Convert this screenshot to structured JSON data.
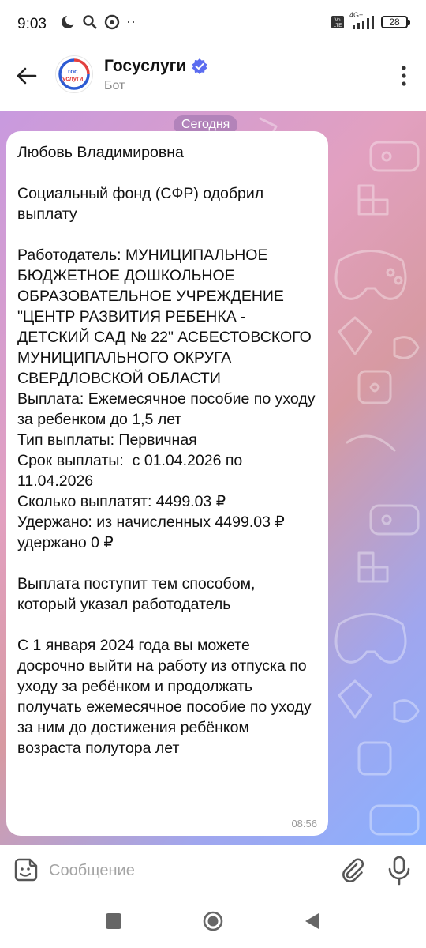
{
  "status_bar": {
    "time": "9:03",
    "battery": "28",
    "network": "4G+",
    "volte": "VoLTE"
  },
  "header": {
    "title": "Госуслуги",
    "subtitle": "Бот",
    "avatar_logo_top": "гос",
    "avatar_logo_bottom": "услуги",
    "icons": {
      "back": "arrow-left-icon",
      "verified": "verified-badge-icon",
      "menu": "more-vertical-icon"
    }
  },
  "chat": {
    "date_label": "Сегодня",
    "message": {
      "text": "Любовь Владимировна\n\nСоциальный фонд (СФР) одобрил выплату\n\nРаботодатель: МУНИЦИПАЛЬНОЕ БЮДЖЕТНОЕ ДОШКОЛЬНОЕ ОБРАЗОВАТЕЛЬНОЕ УЧРЕЖДЕНИЕ \"ЦЕНТР РАЗВИТИЯ РЕБЕНКА - ДЕТСКИЙ САД № 22\" АСБЕСТОВСКОГО МУНИЦИПАЛЬНОГО ОКРУГА СВЕРДЛОВСКОЙ ОБЛАСТИ\nВыплата: Ежемесячное пособие по уходу за ребенком до 1,5 лет\nТип выплаты: Первичная\nСрок выплаты:  с 01.04.2026 по 11.04.2026\nСколько выплатят: 4499.03 ₽\nУдержано: из начисленных 4499.03 ₽ удержано 0 ₽\n\nВыплата поступит тем способом, который указал работодатель\n\nС 1 января 2024 года вы можете досрочно выйти на работу из отпуска по уходу за ребёнком и продолжать получать ежемесячное пособие по уходу за ним до достижения ребёнком возраста полутора лет",
      "time": "08:56"
    }
  },
  "input_bar": {
    "placeholder": "Сообщение",
    "icons": {
      "sticker": "sticker-icon",
      "attach": "paperclip-icon",
      "mic": "microphone-icon"
    }
  },
  "nav_bar": {
    "icons": {
      "recents": "square-icon",
      "home": "circle-icon",
      "back": "triangle-back-icon"
    }
  },
  "colors": {
    "accent": "#5b6cf0",
    "logo_blue": "#2d5bd3",
    "logo_red": "#e2403f"
  }
}
